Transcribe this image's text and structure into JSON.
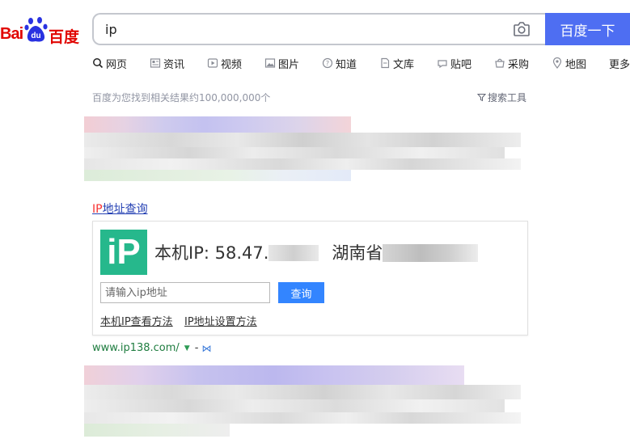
{
  "logo": {
    "bai": "Bai",
    "du": "du",
    "cn": "百度"
  },
  "search": {
    "query": "ip",
    "button_label": "百度一下"
  },
  "tabs": [
    {
      "label": "网页",
      "icon": "search-icon"
    },
    {
      "label": "资讯",
      "icon": "news-icon"
    },
    {
      "label": "视频",
      "icon": "video-icon"
    },
    {
      "label": "图片",
      "icon": "image-icon"
    },
    {
      "label": "知道",
      "icon": "question-icon"
    },
    {
      "label": "文库",
      "icon": "document-icon"
    },
    {
      "label": "贴吧",
      "icon": "tieba-icon"
    },
    {
      "label": "采购",
      "icon": "shop-icon"
    },
    {
      "label": "地图",
      "icon": "map-icon"
    },
    {
      "label": "更多",
      "icon": ""
    }
  ],
  "results": {
    "count_text": "百度为您找到相关结果约100,000,000个",
    "tools_label": "搜索工具"
  },
  "ip_card": {
    "title_highlight": "IP",
    "title_rest": "地址查询",
    "logo_text": "iP",
    "ip_label": "本机IP: 58.47.",
    "location": "湖南省",
    "input_placeholder": "请输入ip地址",
    "query_button": "查询",
    "link1": "本机IP查看方法",
    "link2": "IP地址设置方法"
  },
  "site": {
    "url": "www.ip138.com/",
    "arrow": "▼",
    "dash": "-",
    "badge": "⋈"
  },
  "colors": {
    "brand_blue": "#4e6ef2",
    "baidu_red": "#e10602",
    "title_link": "#2440b3",
    "ip_green": "#26b88c"
  }
}
